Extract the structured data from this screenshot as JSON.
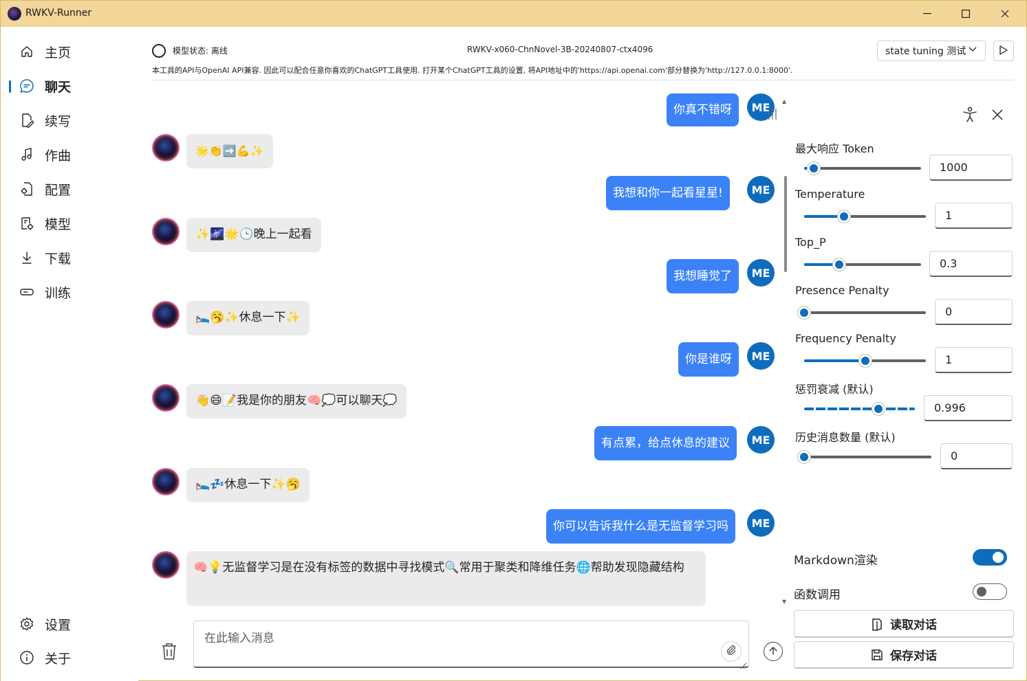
{
  "window": {
    "title": "RWKV-Runner",
    "minimize": "—",
    "maximize": "☐",
    "close": "✕"
  },
  "sidebar": {
    "items": [
      {
        "label": "主页",
        "icon": "home-icon"
      },
      {
        "label": "聊天",
        "icon": "chat-icon",
        "active": true
      },
      {
        "label": "续写",
        "icon": "document-edit-icon"
      },
      {
        "label": "作曲",
        "icon": "music-note-icon"
      },
      {
        "label": "配置",
        "icon": "settings-document-icon"
      },
      {
        "label": "模型",
        "icon": "model-database-icon"
      },
      {
        "label": "下载",
        "icon": "download-icon"
      },
      {
        "label": "训练",
        "icon": "train-icon"
      }
    ],
    "bottom": [
      {
        "label": "设置",
        "icon": "gear-icon"
      },
      {
        "label": "关于",
        "icon": "info-icon"
      }
    ]
  },
  "header": {
    "status": "模型状态: 离线",
    "model": "RWKV-x060-ChnNovel-3B-20240807-ctx4096",
    "preset": "state tuning 测试",
    "api_note": "本工具的API与OpenAI API兼容. 因此可以配合任意你喜欢的ChatGPT工具使用. 打开某个ChatGPT工具的设置, 将API地址中的'https://api.openai.com'部分替换为'http://127.0.0.1:8000'."
  },
  "chat": {
    "messages": [
      {
        "role": "user",
        "text": "你真不错呀"
      },
      {
        "role": "assistant",
        "text": "🌟👏➡️💪✨"
      },
      {
        "role": "user",
        "text": "我想和你一起看星星!"
      },
      {
        "role": "assistant",
        "text": "✨🌌🌟🕒晚上一起看"
      },
      {
        "role": "user",
        "text": "我想睡觉了"
      },
      {
        "role": "assistant",
        "text": "🛌🥱✨休息一下✨"
      },
      {
        "role": "user",
        "text": "你是谁呀"
      },
      {
        "role": "assistant",
        "text": "👋😄📝我是你的朋友🧠💭可以聊天💭"
      },
      {
        "role": "user",
        "text": "有点累，给点休息的建议"
      },
      {
        "role": "assistant",
        "text": "🛌💤休息一下✨🥱"
      },
      {
        "role": "user",
        "text": "你可以告诉我什么是无监督学习吗"
      },
      {
        "role": "assistant",
        "text": "🧠💡无监督学习是在没有标签的数据中寻找模式🔍常用于聚类和降维任务🌐帮助发现隐藏结构"
      }
    ],
    "user_avatar": "ME",
    "input_placeholder": "在此输入消息"
  },
  "params": {
    "max_tokens": {
      "label": "最大响应 Token",
      "value": "1000",
      "fraction": 0.08
    },
    "temperature": {
      "label": "Temperature",
      "value": "1",
      "fraction": 0.33
    },
    "top_p": {
      "label": "Top_P",
      "value": "0.3",
      "fraction": 0.3
    },
    "presence_penalty": {
      "label": "Presence Penalty",
      "value": "0",
      "fraction": 0.0
    },
    "frequency_penalty": {
      "label": "Frequency Penalty",
      "value": "1",
      "fraction": 0.5
    },
    "penalty_decay": {
      "label": "惩罚衰减 (默认)",
      "value": "0.996",
      "fraction": 0.67
    },
    "history_count": {
      "label": "历史消息数量 (默认)",
      "value": "0",
      "fraction": 0.0
    }
  },
  "toggles": {
    "markdown": {
      "label": "Markdown渲染",
      "on": true
    },
    "function_call": {
      "label": "函数调用",
      "on": false
    }
  },
  "actions": {
    "load": "读取对话",
    "save": "保存对话"
  },
  "colors": {
    "accent": "#0f6cbd",
    "user_bubble": "#3b82f6",
    "titlebar": "#f3d699"
  }
}
